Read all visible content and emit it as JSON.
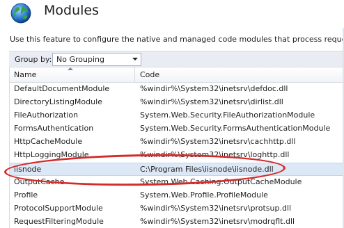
{
  "page": {
    "title": "Modules",
    "description": "Use this feature to configure the native and managed code modules that process requests m",
    "icon": "globe-icon"
  },
  "toolbar": {
    "group_by_label": "Group by:",
    "group_by_value": "No Grouping"
  },
  "grid": {
    "columns": [
      "Name",
      "Code"
    ],
    "sort_column": "Name",
    "rows": [
      {
        "name": "DefaultDocumentModule",
        "code": "%windir%\\System32\\inetsrv\\defdoc.dll"
      },
      {
        "name": "DirectoryListingModule",
        "code": "%windir%\\System32\\inetsrv\\dirlist.dll"
      },
      {
        "name": "FileAuthorization",
        "code": "System.Web.Security.FileAuthorizationModule"
      },
      {
        "name": "FormsAuthentication",
        "code": "System.Web.Security.FormsAuthenticationModule"
      },
      {
        "name": "HttpCacheModule",
        "code": "%windir%\\System32\\inetsrv\\cachhttp.dll"
      },
      {
        "name": "HttpLoggingModule",
        "code": "%windir%\\System32\\inetsrv\\loghttp.dll"
      },
      {
        "name": "iisnode",
        "code": "C:\\Program Files\\iisnode\\iisnode.dll",
        "selected": true
      },
      {
        "name": "OutputCache",
        "code": "System.Web.Caching.OutputCacheModule"
      },
      {
        "name": "Profile",
        "code": "System.Web.Profile.ProfileModule"
      },
      {
        "name": "ProtocolSupportModule",
        "code": "%windir%\\System32\\inetsrv\\protsup.dll"
      },
      {
        "name": "RequestFilteringModule",
        "code": "%windir%\\System32\\inetsrv\\modrqflt.dll"
      }
    ]
  },
  "colors": {
    "selection": "#dde8f6",
    "annotation": "#d62a2a",
    "toolbar_bg": "#e9edf3"
  }
}
